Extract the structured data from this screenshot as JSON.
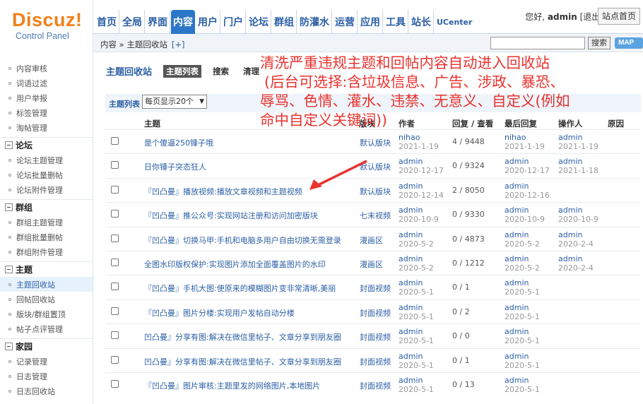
{
  "header": {
    "logo_text": "Discuz!",
    "logo_sub": "Control Panel",
    "nav": [
      {
        "label": "首页"
      },
      {
        "label": "全局"
      },
      {
        "label": "界面"
      },
      {
        "label": "内容",
        "active": true
      },
      {
        "label": "用户"
      },
      {
        "label": "门户"
      },
      {
        "label": "论坛"
      },
      {
        "label": "群组"
      },
      {
        "label": "防灌水"
      },
      {
        "label": "运营"
      },
      {
        "label": "应用"
      },
      {
        "label": "工具"
      },
      {
        "label": "站长"
      },
      {
        "label": "UCenter"
      }
    ],
    "greeting": "您好,",
    "username": "admin",
    "logout_label": "[退出]",
    "site_home_label": "站点首页"
  },
  "breadcrumb": {
    "text": "内容 » 主题回收站",
    "add_label": "[+]"
  },
  "search": {
    "value": "",
    "button_label": "搜索",
    "map_label": "MAP ▼"
  },
  "sidebar": {
    "items_top": [
      "内容审核",
      "词语过滤",
      "用户举报",
      "标签管理",
      "淘帖管理"
    ],
    "groups": [
      {
        "title": "论坛",
        "items": [
          "论坛主题管理",
          "论坛批量删帖",
          "论坛附件管理"
        ]
      },
      {
        "title": "群组",
        "items": [
          "群组主题管理",
          "群组批量删帖",
          "群组附件管理"
        ]
      },
      {
        "title": "主题",
        "items": [
          "主题回收站",
          "回帖回收站",
          "版块/群组置顶",
          "帖子点评管理"
        ]
      },
      {
        "title": "家园",
        "items": [
          "记录管理",
          "日志管理",
          "日志回收站"
        ]
      }
    ],
    "active_item": "主题回收站"
  },
  "main": {
    "title": "主题回收站",
    "tabs": [
      {
        "label": "主题列表",
        "active": true
      },
      {
        "label": "搜索"
      },
      {
        "label": "清理"
      }
    ],
    "list_label": "主题列表",
    "per_page": "每页显示20个",
    "columns": {
      "subject": "主题",
      "forum": "版块",
      "author": "作者",
      "replies_views": "回复 / 查看",
      "last_reply": "最后回复",
      "operator": "操作人",
      "reason": "原因"
    },
    "rows": [
      {
        "subject": "是个傻逼250锤子哦",
        "forum": "默认版块",
        "author": "nihao",
        "author_date": "2021-1-19",
        "rv": "4 / 9448",
        "last_user": "nihao",
        "last_date": "2021-1-19",
        "op_user": "admin",
        "op_date": "2021-1-19"
      },
      {
        "subject": "日你锤子突态狂人",
        "forum": "默认版块",
        "author": "admin",
        "author_date": "2020-12-17",
        "rv": "0 / 9324",
        "last_user": "admin",
        "last_date": "2020-12-17",
        "op_user": "admin",
        "op_date": "2021-1-18"
      },
      {
        "subject": "『凹凸曼』播放视频:播放文章视频和主题视频",
        "forum": "默认版块",
        "author": "admin",
        "author_date": "2020-12-14",
        "rv": "2 / 8050",
        "last_user": "admin",
        "last_date": "2020-12-16",
        "op_user": "",
        "op_date": ""
      },
      {
        "subject": "『凹凸曼』推公众号:实现网站注册和访问加密版块",
        "forum": "七末视频",
        "author": "admin",
        "author_date": "2020-10-9",
        "rv": "0 / 9330",
        "last_user": "admin",
        "last_date": "2020-10-9",
        "op_user": "admin",
        "op_date": "2020-10-9"
      },
      {
        "subject": "『凹凸曼』切换马甲:手机和电脑多用户自由切换无需登录",
        "forum": "漫画区",
        "author": "admin",
        "author_date": "2020-5-2",
        "rv": "0 / 4873",
        "last_user": "admin",
        "last_date": "2020-5-2",
        "op_user": "admin",
        "op_date": "2020-2-4"
      },
      {
        "subject": "全图水印版权保护:实现图片添加全面覆盖图片的水印",
        "forum": "漫画区",
        "author": "admin",
        "author_date": "2020-5-2",
        "rv": "0 / 1212",
        "last_user": "admin",
        "last_date": "2020-5-2",
        "op_user": "admin",
        "op_date": "2020-2-4"
      },
      {
        "subject": "『凹凸曼』手机大图:使原来的模糊图片变非常清晰,美丽",
        "forum": "封面视频",
        "author": "admin",
        "author_date": "2020-5-1",
        "rv": "0 / 1",
        "last_user": "admin",
        "last_date": "2020-5-1",
        "op_user": "",
        "op_date": ""
      },
      {
        "subject": "『凹凸曼』图片分楼:实现用户发帖自动分楼",
        "forum": "封面视频",
        "author": "admin",
        "author_date": "2020-5-1",
        "rv": "0 / 2",
        "last_user": "admin",
        "last_date": "2020-5-1",
        "op_user": "",
        "op_date": ""
      },
      {
        "subject": "凹凸曼』分享有图:解决在微信里帖子、文章分享到朋友圈",
        "forum": "封面视频",
        "author": "admin",
        "author_date": "2020-5-1",
        "rv": "0 / 0",
        "last_user": "admin",
        "last_date": "2020-5-1",
        "op_user": "",
        "op_date": ""
      },
      {
        "subject": "凹凸曼』分享有图:解决在微信里帖子、文章分享到朋友圈",
        "forum": "封面视频",
        "author": "admin",
        "author_date": "2020-5-1",
        "rv": "0 / 1",
        "last_user": "admin",
        "last_date": "2020-5-1",
        "op_user": "",
        "op_date": ""
      },
      {
        "subject": "『凹凸曼』图片审核:主题里发的网络图片,本地图片",
        "forum": "封面视频",
        "author": "admin",
        "author_date": "2020-5-1",
        "rv": "0 / 13",
        "last_user": "admin",
        "last_date": "2020-5-1",
        "op_user": "",
        "op_date": ""
      }
    ]
  },
  "annotation": {
    "line1": "清洗严重违规主题和回帖内容自动进入回收站",
    "line2": "(后台可选择:含垃圾信息、广告、涉政、暴恐、",
    "line3": "辱骂、色情、灌水、违禁、无意义、自定义(例如",
    "line4": "命中自定义关键词))",
    "color": "#e8332f"
  },
  "colors": {
    "link": "#2b5fa5",
    "active_nav": "#2b76c8",
    "logo": "#f0801a"
  }
}
